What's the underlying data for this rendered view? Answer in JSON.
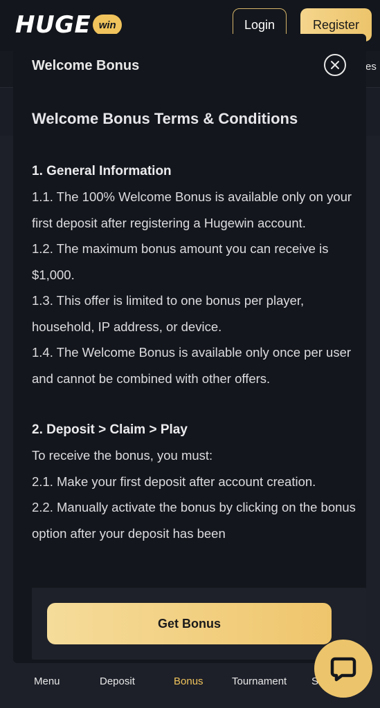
{
  "header": {
    "logo_main": "HUGE",
    "logo_badge": "win",
    "login_label": "Login",
    "register_label": "Register"
  },
  "background": {
    "peek_text": "es"
  },
  "modal": {
    "title": "Welcome Bonus",
    "terms_heading": "Welcome Bonus Terms & Conditions",
    "sections": [
      {
        "title": "1. General Information",
        "items": [
          "1.1. The 100% Welcome Bonus is available only on your first deposit after registering a Hugewin account.",
          "1.2. The maximum bonus amount you can receive is $1,000.",
          "1.3. This offer is limited to one bonus per player, household, IP address, or device.",
          "1.4. The Welcome Bonus is available only once per user and cannot be combined with other offers."
        ]
      },
      {
        "title": "2. Deposit > Claim > Play",
        "items": [
          "To receive the bonus, you must:",
          "2.1. Make your first deposit after account creation.",
          "2.2. Manually activate the bonus by clicking on the bonus option after your deposit has been"
        ]
      }
    ],
    "cta_label": "Get Bonus"
  },
  "bottom_nav": {
    "items": [
      "Menu",
      "Deposit",
      "Bonus",
      "Tournament",
      "S"
    ],
    "active": "Bonus"
  },
  "colors": {
    "accent": "#ecc46b",
    "modal_bg": "#13161c",
    "page_bg": "#1d2029"
  },
  "icons": {
    "close": "close-icon",
    "chat": "chat-icon"
  }
}
